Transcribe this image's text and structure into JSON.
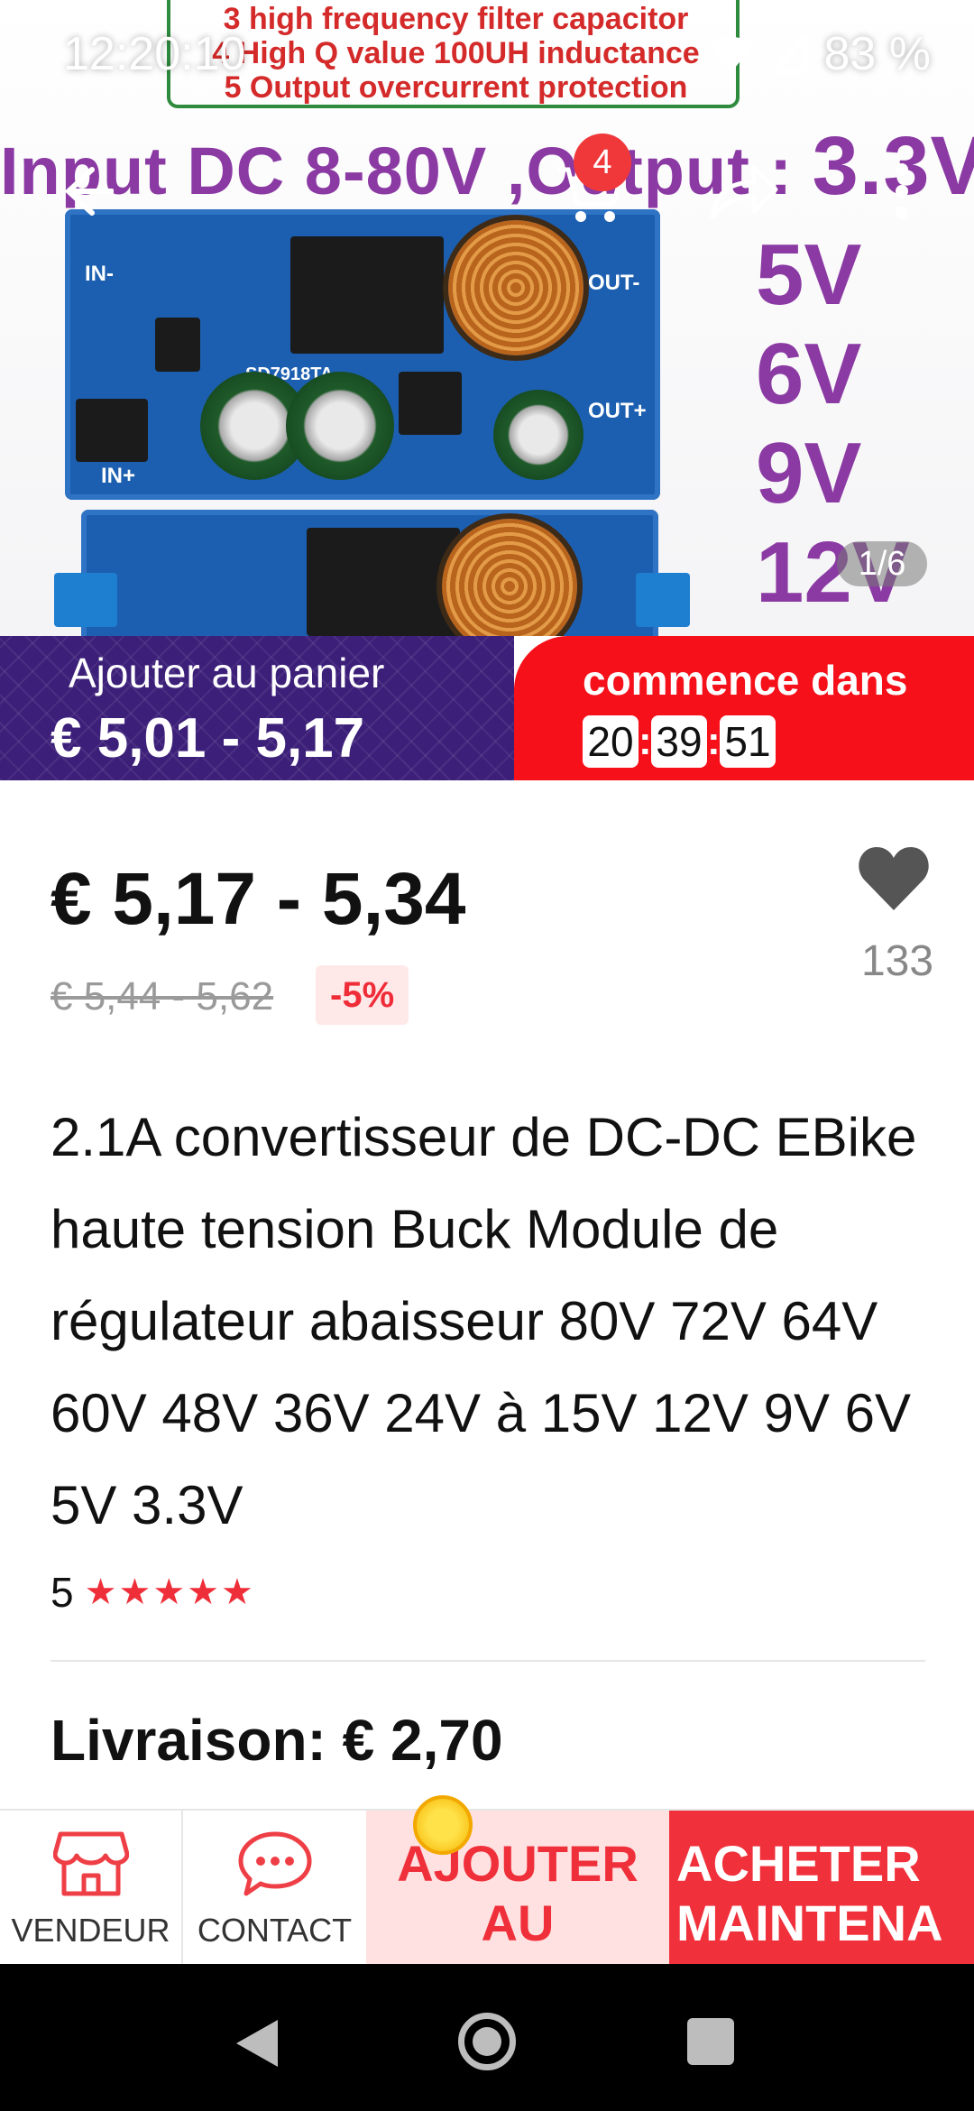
{
  "status_bar": {
    "time": "12:20:10",
    "battery": "83 %"
  },
  "hero": {
    "note_lines": [
      "3 high frequency filter capacitor",
      "4 High Q value 100UH inductance",
      "5 Output overcurrent protection"
    ],
    "headline": "Input DC 8-80V ,Output : ",
    "headline_big": "3.3V",
    "voltages": [
      "5V",
      "6V",
      "9V",
      "12V"
    ],
    "pcb_labels": {
      "in_minus": "IN-",
      "in_plus": "IN+",
      "out_minus": "OUT-",
      "out_plus": "OUT+",
      "chip": "SD7918TA"
    },
    "cart_badge": "4",
    "page_indicator": "1/6"
  },
  "promo": {
    "add_to_cart": "Ajouter au panier",
    "promo_price": "€ 5,01 - 5,17",
    "starts_in": "commence dans",
    "timer": {
      "hours": "20",
      "minutes": "39",
      "seconds": "51"
    }
  },
  "product": {
    "price": "€ 5,17 - 5,34",
    "old_price": "€ 5,44 - 5,62",
    "discount": "-5%",
    "wishlist_count": "133",
    "title": "2.1A convertisseur de DC-DC EBike haute tension Buck Module de régulateur abaisseur 80V 72V 64V 60V 48V 36V 24V à 15V 12V 9V 6V 5V 3.3V",
    "rating": "5",
    "stars": "★★★★★",
    "shipping": "Livraison: € 2,70"
  },
  "actions": {
    "store": "VENDEUR",
    "contact": "CONTACT",
    "add_to_cart": "AJOUTER AU PANIER",
    "buy_now": "ACHETER MAINTENANT"
  },
  "colors": {
    "accent_red": "#f0303a",
    "promo_purple": "#3c1f79",
    "headline_purple": "#8b3aa3"
  }
}
